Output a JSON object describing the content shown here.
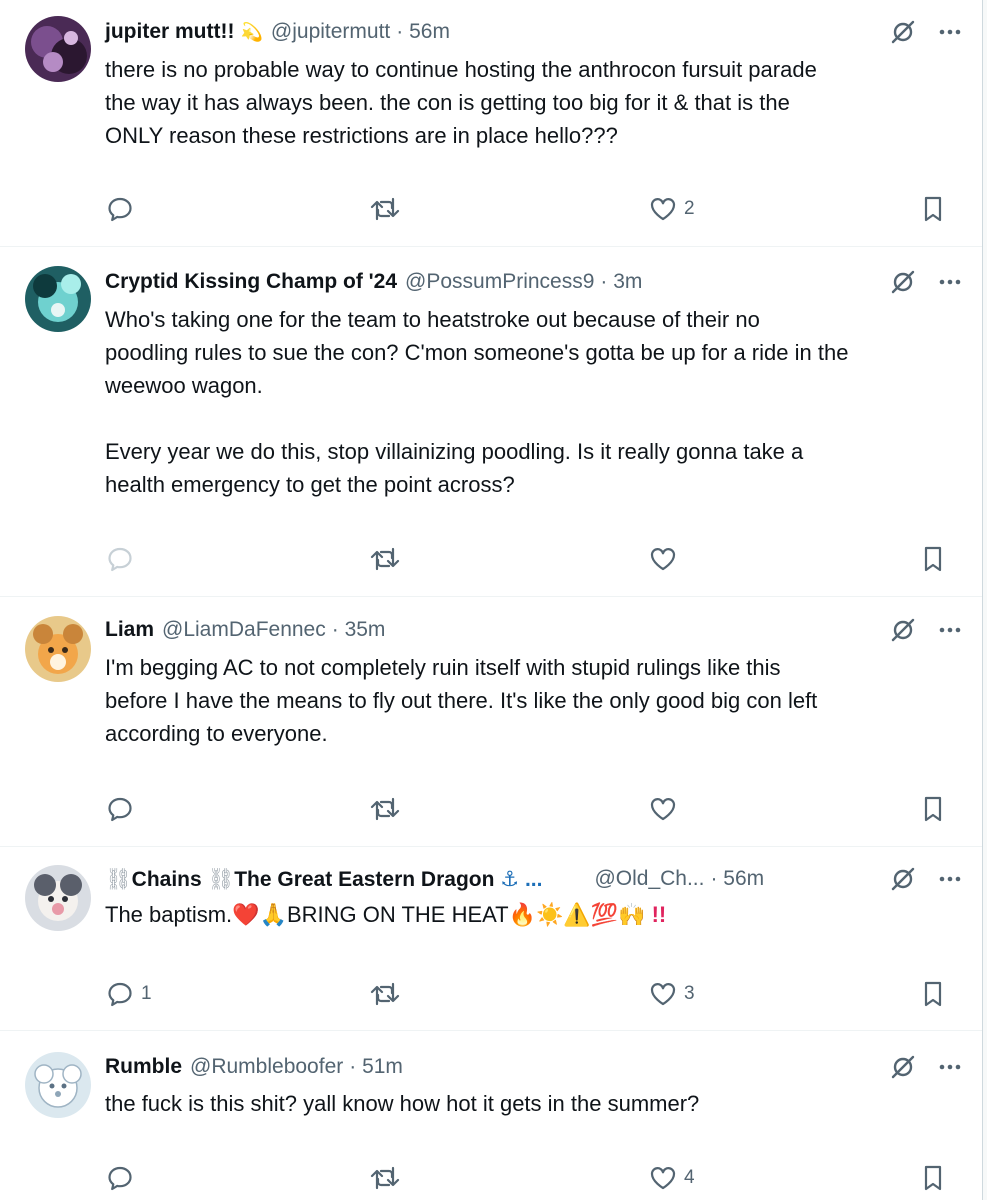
{
  "tweets": [
    {
      "display_name": "jupiter mutt!!",
      "name_emoji": "💫",
      "handle": "@jupitermutt",
      "time": "· 56m",
      "text": "there is no probable way to continue hosting the anthrocon fursuit parade\nthe way it has always been. the con is getting too big for it & that is the\nONLY reason these restrictions are in place hello???",
      "replies": "",
      "retweets": "",
      "likes": "2"
    },
    {
      "display_name": "Cryptid Kissing Champ of '24",
      "handle": "@PossumPrincess9",
      "time": "· 3m",
      "text": "Who's taking one for the team to heatstroke out because of their no\npoodling rules to sue the con? C'mon someone's gotta be up for a ride in the\nweewoo wagon.\n\nEvery year we do this, stop villainizing poodling. Is it really gonna take a\nhealth emergency to get the point across?",
      "replies": "",
      "retweets": "",
      "likes": ""
    },
    {
      "display_name": "Liam",
      "handle": "@LiamDaFennec",
      "time": "· 35m",
      "text": "I'm begging AC to not completely ruin itself with stupid rulings like this\nbefore I have the means to fly out there. It's like the only good big con left\naccording to everyone.",
      "replies": "",
      "retweets": "",
      "likes": ""
    },
    {
      "name_prefix": "⛓",
      "name_part1": "Chains",
      "name_mid": "⛓",
      "name_part2": "The Great Eastern Dragon",
      "name_suffix": "⚓ ...",
      "handle": "@Old_Ch...",
      "time": "· 56m",
      "text_main": "The baptism.❤️🙏BRING ON THE HEAT🔥☀️⚠️💯🙌",
      "text_bang": "!!",
      "replies": "1",
      "retweets": "",
      "likes": "3"
    },
    {
      "display_name": "Rumble",
      "handle": "@Rumbleboofer",
      "time": "· 51m",
      "text": "the fuck is this shit? yall know how hot it gets in the summer?",
      "replies": "",
      "retweets": "",
      "likes": "4"
    }
  ],
  "icons": {
    "reply": "reply-icon",
    "retweet": "retweet-icon",
    "like": "like-icon",
    "bookmark": "bookmark-icon",
    "grok": "grok-icon",
    "more": "more-icon"
  },
  "colors": {
    "text": "#0f1419",
    "secondary": "#536471",
    "divider": "#eff3f4",
    "muted_reply": "#c7d0d6"
  }
}
